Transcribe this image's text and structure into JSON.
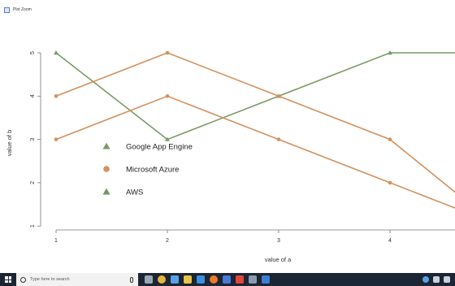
{
  "window": {
    "title": "Plot Zoom"
  },
  "chart_data": {
    "type": "line",
    "xlabel": "value of a",
    "ylabel": "value of b",
    "x_ticks": [
      1,
      2,
      3,
      4
    ],
    "y_ticks": [
      1,
      2,
      3,
      4,
      5
    ],
    "xlim": [
      0.8,
      4.6
    ],
    "ylim": [
      0.8,
      5.3
    ],
    "series": [
      {
        "name": "Google App Engine",
        "color": "#7a9a65",
        "marker": "triangle",
        "x": [
          1,
          2,
          3,
          4,
          4.6
        ],
        "y": [
          5,
          3,
          4,
          5,
          5
        ]
      },
      {
        "name": "Microsoft Azure",
        "color": "#d3915e",
        "marker": "circle",
        "x": [
          1,
          2,
          3,
          4,
          4.6
        ],
        "y": [
          4,
          5,
          4,
          3,
          1.75
        ]
      },
      {
        "name": "AWS",
        "color": "#d3915e",
        "marker": "circle",
        "x": [
          1,
          2,
          3,
          4,
          4.6
        ],
        "y": [
          3,
          4,
          3,
          2,
          1.4
        ]
      }
    ],
    "legend": [
      {
        "name": "Google App Engine",
        "color": "#7a9a65",
        "marker": "triangle"
      },
      {
        "name": "Microsoft Azure",
        "color": "#d3915e",
        "marker": "circle"
      },
      {
        "name": "AWS",
        "color": "#6e9a5c",
        "marker": "triangle"
      }
    ],
    "legend_position": "center-left",
    "grid": false
  },
  "taskbar": {
    "search_placeholder": "Type here to search",
    "icons": [
      "task-view-icon",
      "chrome-icon",
      "settings-icon",
      "file-explorer-icon",
      "edge-icon",
      "firefox-icon",
      "app-icon",
      "tool-icon",
      "app2-icon",
      "mail-icon"
    ],
    "icon_colors": [
      "#9aa7b8",
      "#e8b53a",
      "#5aa0e6",
      "#e9c24a",
      "#3b8fe0",
      "#ef7a2a",
      "#4a79d6",
      "#e2463a",
      "#8a9bb0",
      "#3a7fd0"
    ]
  }
}
